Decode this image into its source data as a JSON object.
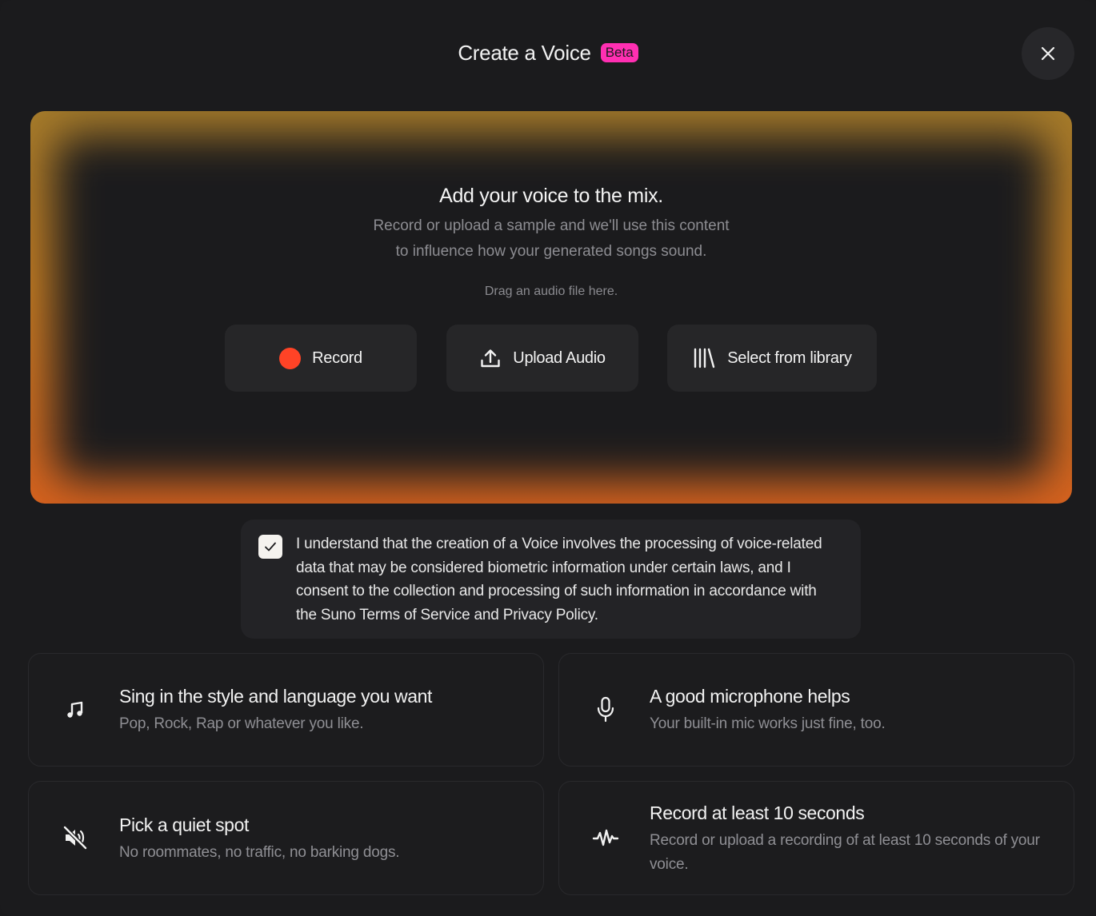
{
  "header": {
    "title": "Create a Voice",
    "badge": "Beta"
  },
  "dropzone": {
    "title": "Add your voice to the mix.",
    "description_line1": "Record or upload a sample and we'll use this content",
    "description_line2": "to influence how your generated songs sound.",
    "drag_hint": "Drag an audio file here.",
    "buttons": {
      "record": "Record",
      "upload": "Upload Audio",
      "library": "Select from library"
    }
  },
  "consent": {
    "checked": true,
    "text": "I understand that the creation of a Voice involves the processing of voice-related data that may be considered biometric information under certain laws, and I consent to the collection and processing of such information in accordance with the Suno Terms of Service and Privacy Policy."
  },
  "tips": [
    {
      "icon": "music-note-icon",
      "title": "Sing in the style and language you want",
      "description": "Pop, Rock, Rap or whatever you like."
    },
    {
      "icon": "microphone-icon",
      "title": "A good microphone helps",
      "description": "Your built-in mic works just fine, too."
    },
    {
      "icon": "speaker-muted-icon",
      "title": "Pick a quiet spot",
      "description": "No roommates, no traffic, no barking dogs."
    },
    {
      "icon": "waveform-icon",
      "title": "Record at least 10 seconds",
      "description": "Record or upload a recording of at least 10 seconds of your voice."
    }
  ],
  "colors": {
    "background": "#1b1b1d",
    "beta_badge": "#ff2fb2",
    "record_dot": "#ff4326",
    "glow_top": "#a47a2a",
    "glow_bottom": "#d4611e"
  }
}
